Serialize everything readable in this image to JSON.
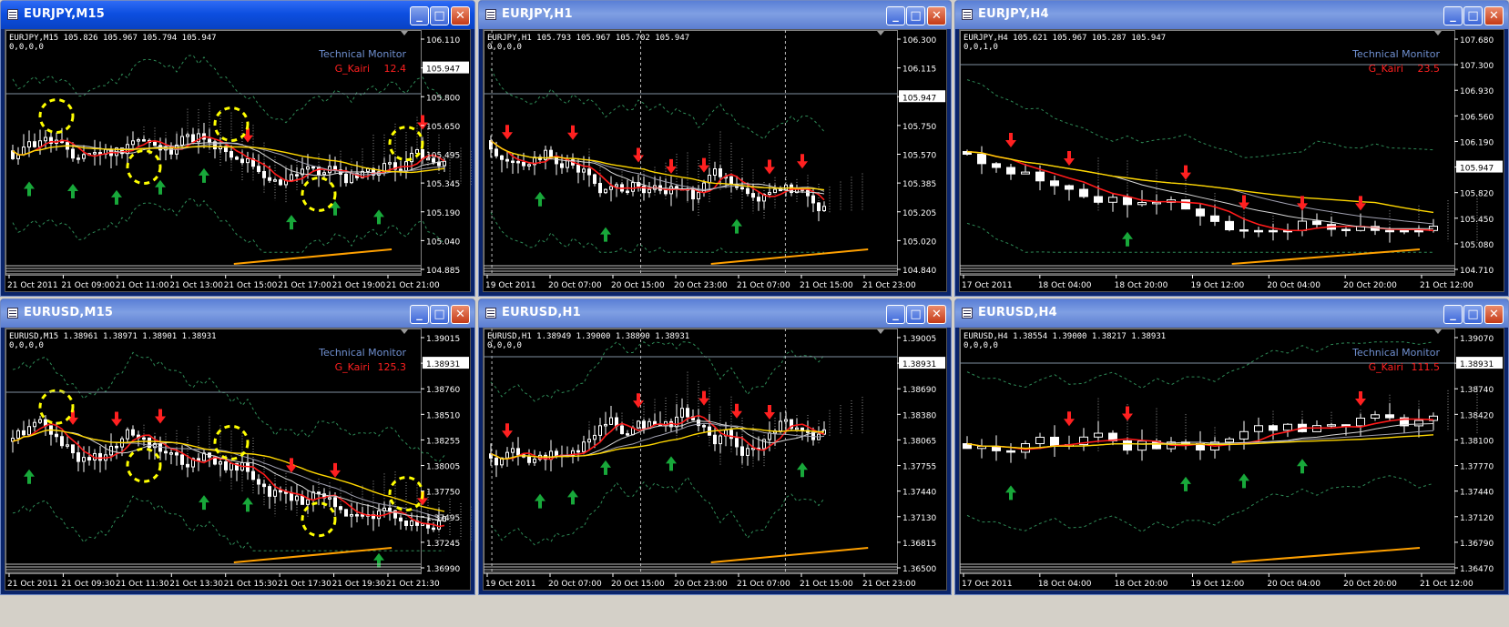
{
  "windows": [
    {
      "title": "EURJPY,M15",
      "active": true,
      "info": "EURJPY,M15  105.826 105.967 105.794 105.947",
      "info2": "0,0,0,0",
      "legend": [
        "Technical Monitor",
        "G_Kairi",
        "12.4"
      ],
      "price_axis": [
        "106.110",
        "105.947",
        "105.800",
        "105.650",
        "105.495",
        "105.345",
        "105.190",
        "105.040",
        "104.885"
      ],
      "highlight": "105.947",
      "time_axis": [
        "21 Oct 2011",
        "21 Oct 09:00",
        "21 Oct 11:00",
        "21 Oct 13:00",
        "21 Oct 15:00",
        "21 Oct 17:00",
        "21 Oct 19:00",
        "21 Oct 21:00"
      ]
    },
    {
      "title": "EURJPY,H1",
      "active": false,
      "info": "EURJPY,H1  105.793 105.967 105.702 105.947",
      "info2": "0,0,0,0",
      "legend": [],
      "price_axis": [
        "106.300",
        "106.115",
        "105.947",
        "105.750",
        "105.570",
        "105.385",
        "105.205",
        "105.020",
        "104.840"
      ],
      "highlight": "105.947",
      "time_axis": [
        "19 Oct 2011",
        "20 Oct 07:00",
        "20 Oct 15:00",
        "20 Oct 23:00",
        "21 Oct 07:00",
        "21 Oct 15:00",
        "21 Oct 23:00"
      ]
    },
    {
      "title": "EURJPY,H4",
      "active": false,
      "info": "EURJPY,H4  105.621 105.967 105.287 105.947",
      "info2": "0,0,1,0",
      "legend": [
        "Technical Monitor",
        "G_Kairi",
        "23.5"
      ],
      "price_axis": [
        "107.680",
        "107.300",
        "106.930",
        "106.560",
        "106.190",
        "105.947",
        "105.820",
        "105.450",
        "105.080",
        "104.710"
      ],
      "highlight": "105.947",
      "time_axis": [
        "17 Oct 2011",
        "18 Oct 04:00",
        "18 Oct 20:00",
        "19 Oct 12:00",
        "20 Oct 04:00",
        "20 Oct 20:00",
        "21 Oct 12:00"
      ]
    },
    {
      "title": "EURUSD,M15",
      "active": false,
      "info": "EURUSD,M15  1.38961 1.38971 1.38901 1.38931",
      "info2": "0,0,0,0",
      "legend": [
        "Technical Monitor",
        "G_Kairi",
        "125.3"
      ],
      "price_axis": [
        "1.39015",
        "1.38931",
        "1.38760",
        "1.38510",
        "1.38255",
        "1.38005",
        "1.37750",
        "1.37495",
        "1.37245",
        "1.36990"
      ],
      "highlight": "1.38931",
      "time_axis": [
        "21 Oct 2011",
        "21 Oct 09:30",
        "21 Oct 11:30",
        "21 Oct 13:30",
        "21 Oct 15:30",
        "21 Oct 17:30",
        "21 Oct 19:30",
        "21 Oct 21:30"
      ]
    },
    {
      "title": "EURUSD,H1",
      "active": false,
      "info": "EURUSD,H1  1.38949 1.39000 1.38890 1.38931",
      "info2": "0,0,0,0",
      "legend": [],
      "price_axis": [
        "1.39005",
        "1.38931",
        "1.38690",
        "1.38380",
        "1.38065",
        "1.37755",
        "1.37440",
        "1.37130",
        "1.36815",
        "1.36500"
      ],
      "highlight": "1.38931",
      "time_axis": [
        "19 Oct 2011",
        "20 Oct 07:00",
        "20 Oct 15:00",
        "20 Oct 23:00",
        "21 Oct 07:00",
        "21 Oct 15:00",
        "21 Oct 23:00"
      ]
    },
    {
      "title": "EURUSD,H4",
      "active": false,
      "info": "EURUSD,H4  1.38554 1.39000 1.38217 1.38931",
      "info2": "0,0,0,0",
      "legend": [
        "Technical Monitor",
        "G_Kairi",
        "111.5"
      ],
      "price_axis": [
        "1.39070",
        "1.38931",
        "1.38740",
        "1.38420",
        "1.38100",
        "1.37770",
        "1.37440",
        "1.37120",
        "1.36790",
        "1.36470"
      ],
      "highlight": "1.38931",
      "time_axis": [
        "17 Oct 2011",
        "18 Oct 04:00",
        "18 Oct 20:00",
        "19 Oct 12:00",
        "20 Oct 04:00",
        "20 Oct 20:00",
        "21 Oct 12:00"
      ]
    }
  ],
  "colors": {
    "background": "#000000",
    "bull": "#ffffff",
    "bear": "#ffffff",
    "ma_red": "#ff1a1a",
    "ma_white": "#d8d8d8",
    "ma_gray": "#a0a0b0",
    "ma_yellow": "#ffd700",
    "ma_orange": "#ffa000",
    "band": "#2e8b57",
    "cloud": "#b0b0b0",
    "buy_arrow": "#18a83a",
    "sell_arrow": "#ff2020",
    "highlight_circle": "#ffff00",
    "legend_text": "#6f8fd0",
    "kairi": "#ff2020"
  }
}
